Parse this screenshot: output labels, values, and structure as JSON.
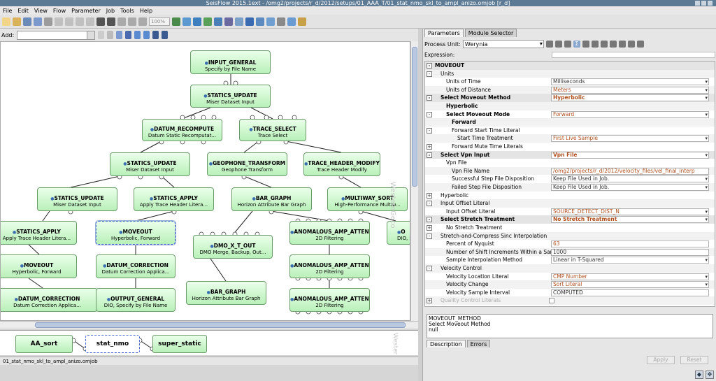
{
  "title": "SeisFlow 2015.1ext - /omg2/projects/r_d/2012/setups/01_AAA_T/01_stat_nmo_skl_to_ampl_anizo.omjob [r_d]",
  "menu": [
    "File",
    "Edit",
    "View",
    "Flow",
    "Parameter",
    "Job",
    "Tools",
    "Help"
  ],
  "toolbar": {
    "zoom": "100%"
  },
  "addbar": {
    "label": "Add:"
  },
  "canvas": {
    "watermark": "WesternGeco"
  },
  "nodes": [
    {
      "id": "input_general",
      "t": "INPUT_GENERAL",
      "s": "Specify by File Name"
    },
    {
      "id": "statics_update_1",
      "t": "STATICS_UPDATE",
      "s": "Miser Dataset Input"
    },
    {
      "id": "datum_recompute",
      "t": "DATUM_RECOMPUTE",
      "s": "Datum Static Recomputat..."
    },
    {
      "id": "trace_select",
      "t": "TRACE_SELECT",
      "s": "Trace Select"
    },
    {
      "id": "statics_update_2",
      "t": "STATICS_UPDATE",
      "s": "Miser Dataset Input"
    },
    {
      "id": "geophone_transform",
      "t": "GEOPHONE_TRANSFORM",
      "s": "Geophone Transform"
    },
    {
      "id": "trace_header_modify",
      "t": "TRACE_HEADER_MODIFY",
      "s": "Trace Header Modify"
    },
    {
      "id": "statics_update_3",
      "t": "STATICS_UPDATE",
      "s": "Miser Dataset Input"
    },
    {
      "id": "statics_apply_1",
      "t": "STATICS_APPLY",
      "s": "Apply Trace Header Litera..."
    },
    {
      "id": "bar_graph_1",
      "t": "BAR_GRAPH",
      "s": "Horizon Attribute Bar Graph"
    },
    {
      "id": "multiway_sort",
      "t": "MULTIWAY_SORT",
      "s": "High-Performance Multiw..."
    },
    {
      "id": "statics_apply_2",
      "t": "STATICS_APPLY",
      "s": "Apply Trace Header Litera..."
    },
    {
      "id": "moveout_1",
      "t": "MOVEOUT",
      "s": "Hyperbolic, Forward"
    },
    {
      "id": "dmo_x_t_out",
      "t": "DMO_X_T_OUT",
      "s": "DMO Merge, Backup, Out..."
    },
    {
      "id": "anomalous_1",
      "t": "ANOMALOUS_AMP_ATTEN",
      "s": "2D Filtering"
    },
    {
      "id": "o_node",
      "t": "O",
      "s": "DIO, S"
    },
    {
      "id": "moveout_2",
      "t": "MOVEOUT",
      "s": "Hyperbolic, Forward"
    },
    {
      "id": "datum_correction_1",
      "t": "DATUM_CORRECTION",
      "s": "Datum Correction Applica..."
    },
    {
      "id": "anomalous_2",
      "t": "ANOMALOUS_AMP_ATTEN",
      "s": "2D Filtering"
    },
    {
      "id": "datum_correction_2",
      "t": "DATUM_CORRECTION",
      "s": "Datum Correction Applica..."
    },
    {
      "id": "output_general",
      "t": "OUTPUT_GENERAL",
      "s": "DIO, Specify by File Name"
    },
    {
      "id": "bar_graph_2",
      "t": "BAR_GRAPH",
      "s": "Horizon Attribute Bar Graph"
    },
    {
      "id": "anomalous_3",
      "t": "ANOMALOUS_AMP_ATTEN",
      "s": "2D Filtering"
    }
  ],
  "jobstrip": {
    "items": [
      "AA_sort",
      "stat_nmo",
      "super_static"
    ],
    "watermark": "WesternGeco"
  },
  "statusbar": {
    "file": "01_stat_nmo_skl_to_ampl_anizo.omjob"
  },
  "panel": {
    "tabs": [
      "Parameters",
      "Module Selector"
    ],
    "process_unit_label": "Process Unit:",
    "process_unit_value": "Werynia",
    "expression_label": "Expression:",
    "rows": [
      {
        "toggle": "-",
        "label": "MOVEOUT",
        "bold": true,
        "header": true
      },
      {
        "toggle": "-",
        "label": "Units"
      },
      {
        "label": "Units of Time",
        "value": "Milliseconds",
        "drop": true
      },
      {
        "label": "Units of Distance",
        "value": "Meters",
        "drop": true,
        "orange": true
      },
      {
        "toggle": "-",
        "label": "Select Moveout Method",
        "bold": true,
        "header": true,
        "value": "Hyperbolic",
        "drop": true,
        "orange": true
      },
      {
        "label": "Hyperbolic",
        "bold": true
      },
      {
        "toggle": "-",
        "label": "Select Moveout Mode",
        "bold": true,
        "value": "Forward",
        "drop": true,
        "orange": true
      },
      {
        "label": "Forward",
        "bold": true
      },
      {
        "toggle": "-",
        "label": "Forward Start Time Literal"
      },
      {
        "label": "Start Time Treatment",
        "value": "First Live Sample",
        "drop": true,
        "orange": true
      },
      {
        "toggle": "+",
        "label": "Forward Mute Time Literals"
      },
      {
        "toggle": "-",
        "label": "Select Vpn  Input",
        "bold": true,
        "header": true,
        "value": "Vpn File",
        "drop": true,
        "orange": true
      },
      {
        "label": "Vpn File"
      },
      {
        "label": "Vpn File Name",
        "value": "/omg2/projects/r_d/2012/velocity_files/vel_final_interp",
        "orange": true
      },
      {
        "label": "Successful Step File Disposition",
        "value": "Keep File Used in Job.",
        "drop": true
      },
      {
        "label": "Failed Step File Disposition",
        "value": "Keep File Used in Job.",
        "drop": true
      },
      {
        "toggle": "+",
        "label": "Hyperbolic"
      },
      {
        "toggle": "-",
        "label": "Input Offset Literal"
      },
      {
        "label": "Input Offset Literal",
        "value": "SOURCE_DETECT_DIST_N",
        "drop": true,
        "orange": true
      },
      {
        "toggle": "-",
        "label": "Select Stretch Treatment",
        "bold": true,
        "header": true,
        "value": "No Stretch Treatment",
        "drop": true,
        "orange": true
      },
      {
        "toggle": "+",
        "label": "No Stretch Treatment"
      },
      {
        "toggle": "-",
        "label": "Stretch-and-Compress Sinc Interpolation"
      },
      {
        "label": "Percent of Nyquist",
        "value": "63",
        "orange": true
      },
      {
        "label": "Number of Shift Increments Within a Sample ...",
        "value": "1000"
      },
      {
        "label": "Sample Interpolation Method",
        "value": "Linear in T-Squared",
        "drop": true
      },
      {
        "toggle": "-",
        "label": "Velocity Control"
      },
      {
        "label": "Velocity Location Literal",
        "value": "CMP Number",
        "drop": true,
        "orange": true
      },
      {
        "label": "Velocity Change",
        "value": "Sort Literal",
        "drop": true,
        "orange": true
      },
      {
        "label": "Velocity Sample Interval",
        "value": "COMPUTED"
      },
      {
        "toggle": "+",
        "label": "Quality Control Literals",
        "grey": true,
        "check": true
      }
    ],
    "description": [
      "MOVEOUT_METHOD",
      "Select Moveout Method",
      "null"
    ],
    "desc_tabs": [
      "Description",
      "Errors"
    ],
    "buttons": [
      "Apply",
      "Reset"
    ]
  }
}
